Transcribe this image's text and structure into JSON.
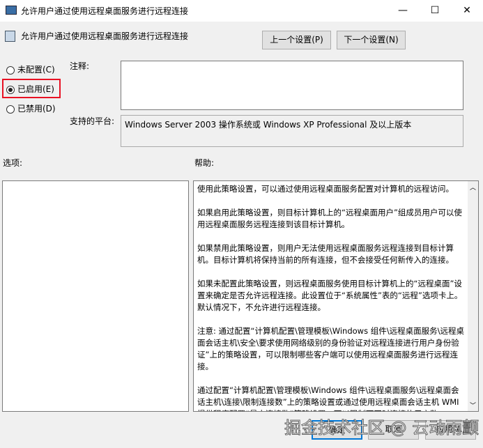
{
  "window": {
    "title": "允许用户通过使用远程桌面服务进行远程连接",
    "minimize": "—",
    "maximize": "☐",
    "close": "✕"
  },
  "header": {
    "policy_title": "允许用户通过使用远程桌面服务进行远程连接",
    "prev_button": "上一个设置(P)",
    "next_button": "下一个设置(N)"
  },
  "state": {
    "options": [
      {
        "label": "未配置(C)",
        "selected": false
      },
      {
        "label": "已启用(E)",
        "selected": true
      },
      {
        "label": "已禁用(D)",
        "selected": false
      }
    ]
  },
  "comment": {
    "label": "注释:",
    "value": ""
  },
  "platform": {
    "label": "支持的平台:",
    "value": "Windows Server 2003 操作系统或 Windows XP Professional 及以上版本"
  },
  "options_label": "选项:",
  "help_label": "帮助:",
  "help_paragraphs": [
    "使用此策略设置，可以通过使用远程桌面服务配置对计算机的远程访问。",
    "如果启用此策略设置，则目标计算机上的“远程桌面用户”组成员用户可以使用远程桌面服务远程连接到该目标计算机。",
    "如果禁用此策略设置，则用户无法使用远程桌面服务远程连接到目标计算机。目标计算机将保持当前的所有连接，但不会接受任何新传入的连接。",
    "如果未配置此策略设置，则远程桌面服务使用目标计算机上的“远程桌面”设置来确定是否允许远程连接。此设置位于“系统属性”表的“远程”选项卡上。默认情况下，不允许进行远程连接。",
    "注意: 通过配置“计算机配置\\管理模板\\Windows 组件\\远程桌面服务\\远程桌面会话主机\\安全\\要求使用网络级别的身份验证对远程连接进行用户身份验证”上的策略设置，可以限制哪些客户端可以使用远程桌面服务进行远程连接。",
    "通过配置“计算机配置\\管理模板\\Windows 组件\\远程桌面服务\\远程桌面会话主机\\连接\\限制连接数”上的策略设置或通过使用远程桌面会话主机 WMI 提供程序配置“最大连接数”策略设置，可以限制可同时连接的用户数。"
  ],
  "footer": {
    "ok": "确定",
    "cancel": "取消",
    "apply": "应用(A)"
  },
  "watermark": "掘金技术社区 @ 云动雨颤",
  "colors": {
    "highlight": "#e81123",
    "focus": "#0078d7"
  }
}
